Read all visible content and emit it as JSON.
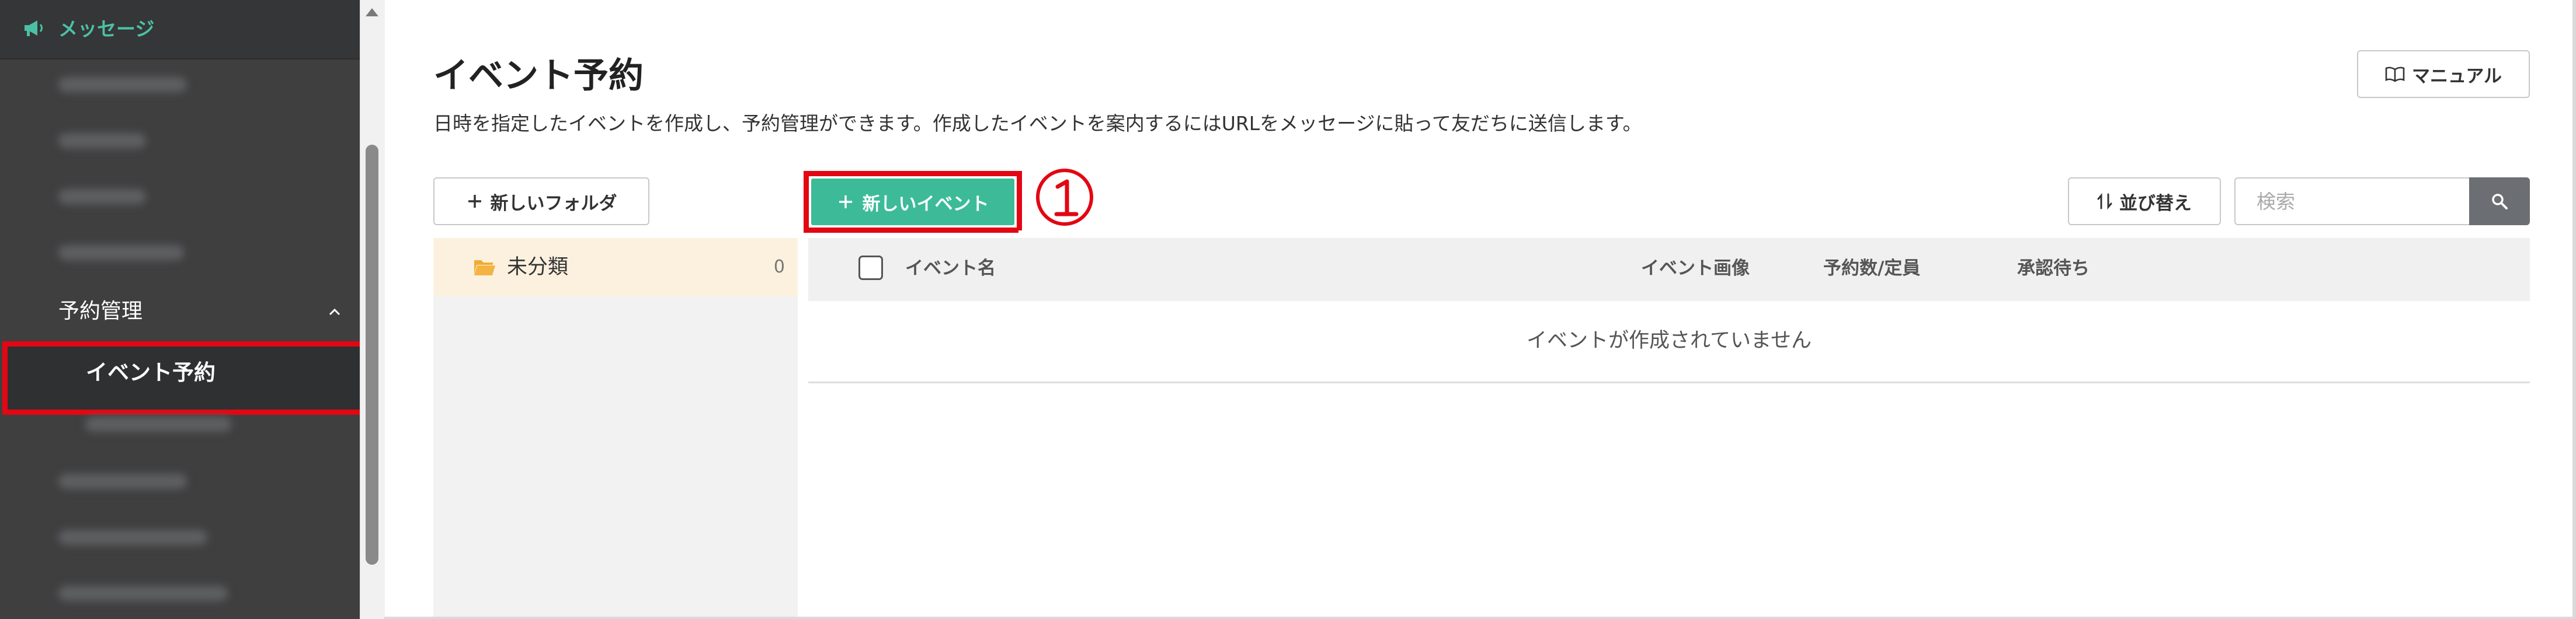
{
  "sidebar": {
    "header_label": "メッセージ",
    "section_label": "予約管理",
    "active_item": "イベント予約"
  },
  "page": {
    "title": "イベント予約",
    "description": "日時を指定したイベントを作成し、予約管理ができます。作成したイベントを案内するにはURLをメッセージに貼って友だちに送信します。"
  },
  "toolbar": {
    "manual_label": "マニュアル",
    "new_folder_label": "新しいフォルダ",
    "new_event_label": "新しいイベント",
    "step_marker": "①",
    "sort_label": "並び替え",
    "search_placeholder": "検索"
  },
  "folders": [
    {
      "name": "未分類",
      "count": "0"
    }
  ],
  "table": {
    "columns": [
      "イベント名",
      "イベント画像",
      "予約数/定員",
      "承認待ち"
    ],
    "empty_message": "イベントが作成されていません"
  },
  "colors": {
    "accent_green": "#3dbb99",
    "highlight_red": "#e30613",
    "sidebar_bg": "#3f3f40",
    "sidebar_header_text": "#4bc0a6"
  }
}
